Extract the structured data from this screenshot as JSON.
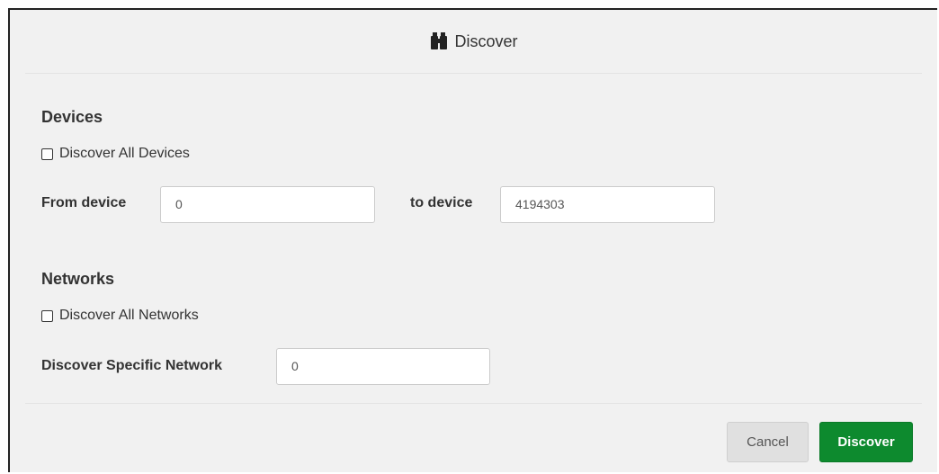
{
  "dialog": {
    "title": "Discover",
    "title_icon": "binoculars-icon"
  },
  "devices": {
    "heading": "Devices",
    "discover_all_label": "Discover All Devices",
    "discover_all_checked": false,
    "from_label": "From device",
    "from_value": "0",
    "to_label": "to device",
    "to_value": "4194303"
  },
  "networks": {
    "heading": "Networks",
    "discover_all_label": "Discover All Networks",
    "discover_all_checked": false,
    "specific_label": "Discover Specific Network",
    "specific_value": "0"
  },
  "footer": {
    "cancel_label": "Cancel",
    "discover_label": "Discover"
  },
  "colors": {
    "primary_button": "#0d8a2e",
    "dialog_background": "#f1f1f1"
  }
}
